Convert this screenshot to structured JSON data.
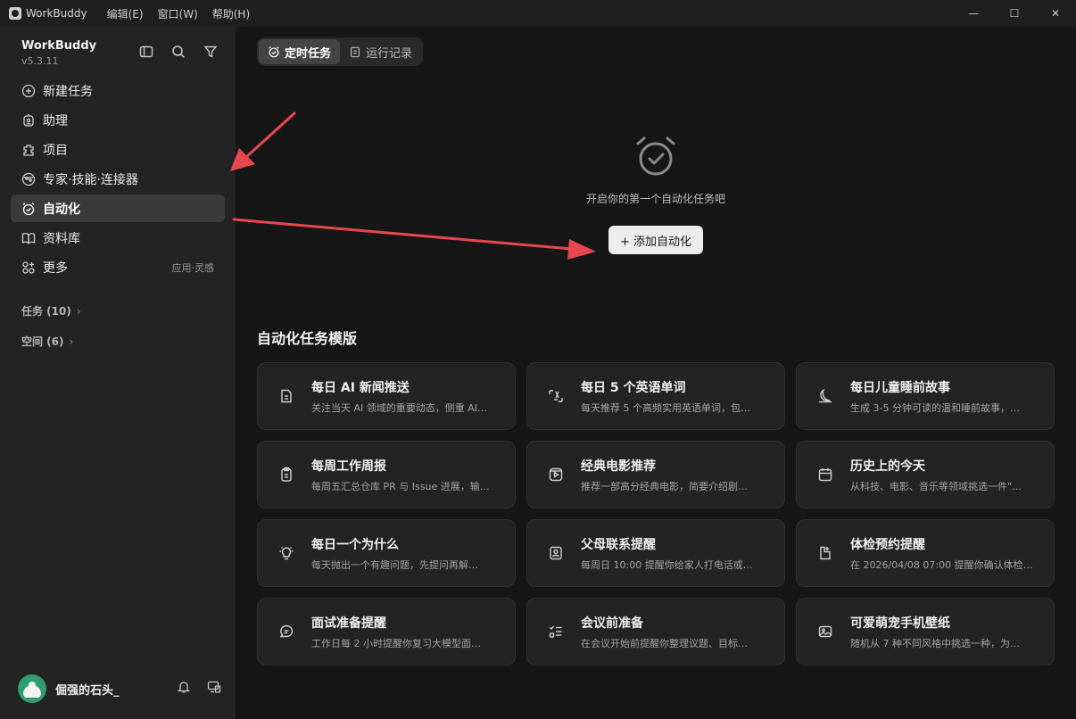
{
  "window": {
    "app_name": "WorkBuddy",
    "menus": [
      "编辑(E)",
      "窗口(W)",
      "帮助(H)"
    ],
    "controls": {
      "minimize": "—",
      "maximize": "☐",
      "close": "✕"
    }
  },
  "sidebar": {
    "brand_name": "WorkBuddy",
    "version": "v5.3.11",
    "nav": [
      {
        "label": "新建任务",
        "icon": "plus-circle-icon"
      },
      {
        "label": "助理",
        "icon": "assistant-icon"
      },
      {
        "label": "项目",
        "icon": "project-icon"
      },
      {
        "label": "专家·技能·连接器",
        "icon": "expert-icon"
      },
      {
        "label": "自动化",
        "icon": "alarm-clock-icon",
        "active": true
      },
      {
        "label": "资料库",
        "icon": "book-icon"
      },
      {
        "label": "更多",
        "icon": "grid-plus-icon",
        "hint": "应用·灵感"
      }
    ],
    "sections": {
      "tasks": "任务 (10)",
      "spaces": "空间 (6)"
    },
    "user": {
      "name": "倔强的石头_"
    }
  },
  "main": {
    "tabs": [
      {
        "label": "定时任务",
        "active": true
      },
      {
        "label": "运行记录",
        "active": false
      }
    ],
    "empty_text": "开启你的第一个自动化任务吧",
    "add_button": "+ 添加自动化",
    "templates_title": "自动化任务模版",
    "templates": [
      {
        "title": "每日 AI 新闻推送",
        "desc": "关注当天 AI 领域的重要动态，侧重 AI…",
        "icon": "document-icon"
      },
      {
        "title": "每日 5 个英语单词",
        "desc": "每天推荐 5 个高频实用英语单词，包…",
        "icon": "translate-icon"
      },
      {
        "title": "每日儿童睡前故事",
        "desc": "生成 3-5 分钟可读的温和睡前故事，…",
        "icon": "moon-icon"
      },
      {
        "title": "每周工作周报",
        "desc": "每周五汇总仓库 PR 与 Issue 进展，输…",
        "icon": "clipboard-icon"
      },
      {
        "title": "经典电影推荐",
        "desc": "推荐一部高分经典电影，简要介绍剧…",
        "icon": "film-icon"
      },
      {
        "title": "历史上的今天",
        "desc": "从科技、电影、音乐等领域挑选一件\"…",
        "icon": "calendar-icon"
      },
      {
        "title": "每日一个为什么",
        "desc": "每天抛出一个有趣问题，先提问再解…",
        "icon": "lightbulb-icon"
      },
      {
        "title": "父母联系提醒",
        "desc": "每周日 10:00 提醒你给家人打电话或…",
        "icon": "contact-icon"
      },
      {
        "title": "体检预约提醒",
        "desc": "在 2026/04/08 07:00 提醒你确认体检…",
        "icon": "health-icon"
      },
      {
        "title": "面试准备提醒",
        "desc": "工作日每 2 小时提醒你复习大模型面…",
        "icon": "chat-bubble-icon"
      },
      {
        "title": "会议前准备",
        "desc": "在会议开始前提醒你整理议题、目标…",
        "icon": "checklist-icon"
      },
      {
        "title": "可爱萌宠手机壁纸",
        "desc": "随机从 7 种不同风格中挑选一种，为…",
        "icon": "image-icon"
      }
    ]
  },
  "colors": {
    "annotation_arrow": "#e8474f",
    "active_nav": "#3a3a3a"
  }
}
